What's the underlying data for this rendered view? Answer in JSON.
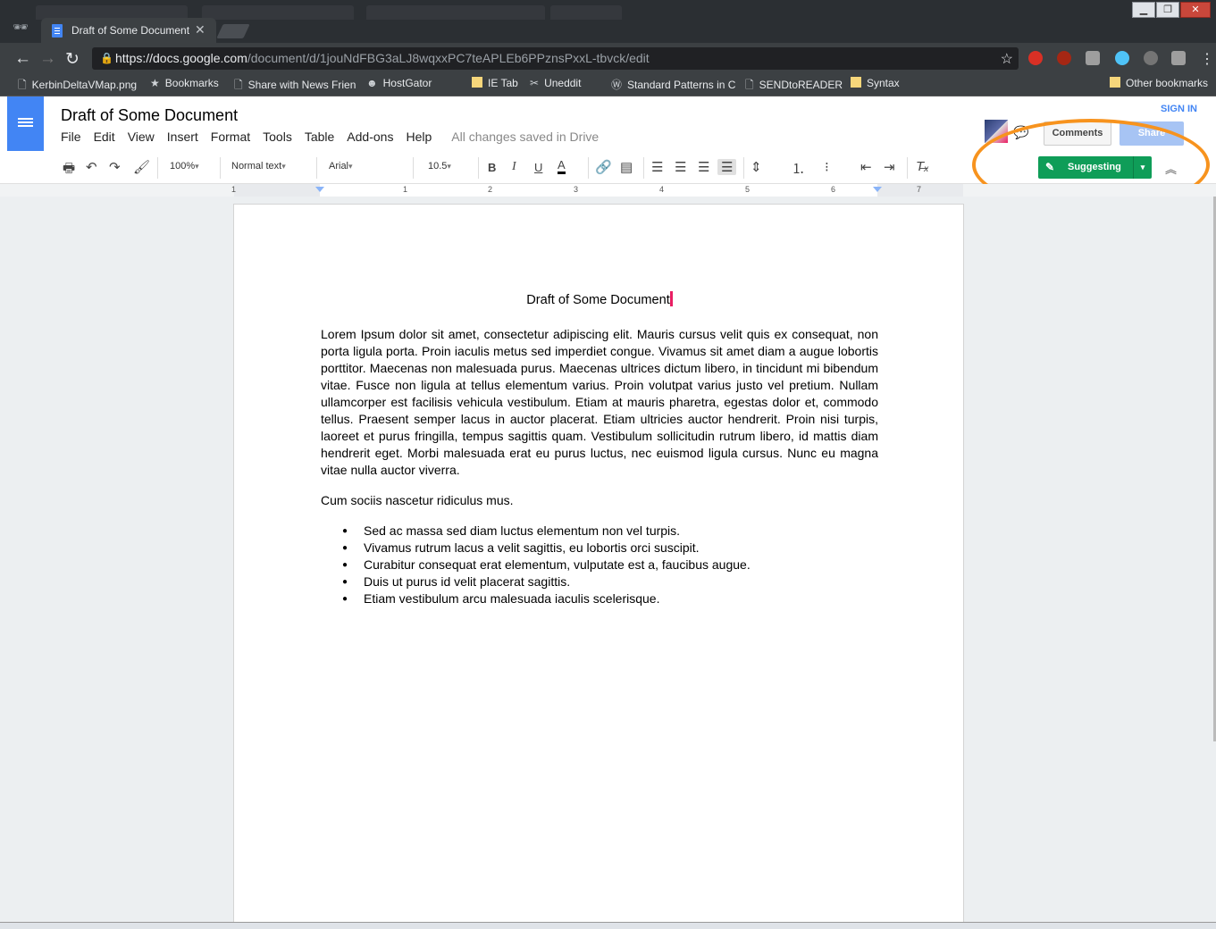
{
  "browser": {
    "tab_title": "Draft of Some Document",
    "tab_close": "✕",
    "url_host": "https://docs.google.com",
    "url_path": "/document/d/1jouNdFBG3aLJ8wqxxPC7teAPLEb6PPznsPxxL-tbvck/edit",
    "window_buttons": [
      "▁",
      "❐",
      "✕"
    ],
    "bookmarks": [
      {
        "label": "KerbinDeltaVMap.png",
        "icon": "page-icon"
      },
      {
        "label": "Bookmarks",
        "icon": "star-icon"
      },
      {
        "label": "Share with News Frien",
        "icon": "page-icon"
      },
      {
        "label": "HostGator",
        "icon": "hostgator-icon"
      },
      {
        "label": "IE Tab",
        "icon": "folder-icon"
      },
      {
        "label": "Uneddit",
        "icon": "scissors-icon"
      },
      {
        "label": "Standard Patterns in C",
        "icon": "wordpress-icon"
      },
      {
        "label": "SENDtoREADER",
        "icon": "page-icon"
      },
      {
        "label": "Syntax",
        "icon": "folder-icon"
      }
    ],
    "other_bookmarks": "Other bookmarks"
  },
  "docs": {
    "title": "Draft of Some Document",
    "menu": [
      "File",
      "Edit",
      "View",
      "Insert",
      "Format",
      "Tools",
      "Table",
      "Add-ons",
      "Help"
    ],
    "saved_status": "All changes saved in Drive",
    "sign_in": "SIGN IN",
    "comments": "Comments",
    "share": "Share",
    "toolbar": {
      "zoom": "100%",
      "style": "Normal text",
      "font": "Arial",
      "size": "10.5",
      "bold": "B",
      "italic": "I",
      "underline": "U",
      "text_color": "A"
    },
    "mode": "Suggesting",
    "ruler_numbers": [
      "1",
      "1",
      "2",
      "3",
      "4",
      "5",
      "6",
      "7"
    ]
  },
  "document": {
    "heading": "Draft of Some Document",
    "paragraph1": "Lorem Ipsum dolor sit amet, consectetur adipiscing elit. Mauris cursus velit quis ex consequat, non porta ligula porta. Proin iaculis metus sed imperdiet congue. Vivamus sit amet diam a augue lobortis porttitor. Maecenas non malesuada purus. Maecenas ultrices dictum libero, in tincidunt mi bibendum vitae. Fusce non ligula at tellus elementum varius. Proin volutpat varius justo vel pretium. Nullam ullamcorper est facilisis vehicula vestibulum. Etiam at mauris pharetra, egestas dolor et, commodo tellus. Praesent semper lacus in auctor placerat. Etiam ultricies auctor hendrerit. Proin nisi turpis, laoreet et purus fringilla, tempus sagittis quam. Vestibulum sollicitudin rutrum libero, id mattis diam hendrerit eget. Morbi malesuada erat eu purus luctus, nec euismod ligula cursus. Nunc eu magna vitae nulla auctor viverra.",
    "paragraph2": "Cum sociis nascetur ridiculus mus.",
    "bullets": [
      "Sed ac massa sed diam luctus elementum non vel turpis.",
      "Vivamus rutrum lacus a velit sagittis, eu lobortis orci suscipit.",
      "Curabitur consequat erat elementum, vulputate est a, faucibus augue.",
      "Duis ut purus id velit placerat sagittis.",
      "Etiam vestibulum arcu malesuada iaculis scelerisque."
    ]
  },
  "colors": {
    "docs_blue": "#4285f4",
    "suggesting_green": "#0f9d58",
    "annotation_orange": "#f7931e",
    "suggestion_pink": "#e91e63"
  }
}
